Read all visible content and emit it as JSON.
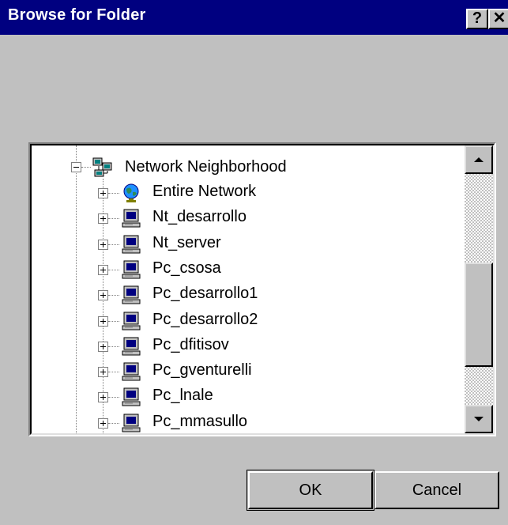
{
  "window": {
    "title": "Browse for Folder",
    "help_glyph": "?",
    "close_glyph": "✕"
  },
  "tree": {
    "root": {
      "label": "Network Neighborhood",
      "expanded": true,
      "icon": "network-neighborhood-icon"
    },
    "children": [
      {
        "label": "Entire Network",
        "icon": "globe-icon"
      },
      {
        "label": "Nt_desarrollo",
        "icon": "computer-icon"
      },
      {
        "label": "Nt_server",
        "icon": "computer-icon"
      },
      {
        "label": "Pc_csosa",
        "icon": "computer-icon"
      },
      {
        "label": "Pc_desarrollo1",
        "icon": "computer-icon"
      },
      {
        "label": "Pc_desarrollo2",
        "icon": "computer-icon"
      },
      {
        "label": "Pc_dfitisov",
        "icon": "computer-icon"
      },
      {
        "label": "Pc_gventurelli",
        "icon": "computer-icon"
      },
      {
        "label": "Pc_lnale",
        "icon": "computer-icon"
      },
      {
        "label": "Pc_mmasullo",
        "icon": "computer-icon"
      }
    ]
  },
  "buttons": {
    "ok_label": "OK",
    "cancel_label": "Cancel"
  },
  "colors": {
    "titlebar": "#000080",
    "face": "#c0c0c0"
  }
}
